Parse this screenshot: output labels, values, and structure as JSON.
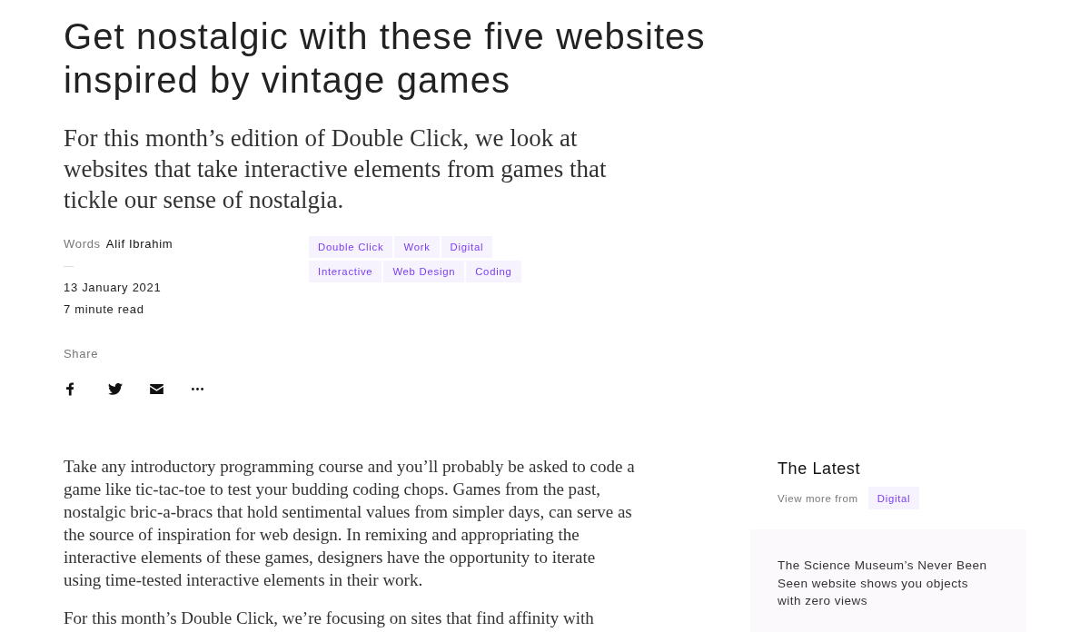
{
  "article": {
    "title": "Get nostalgic with these five websites inspired by vintage games",
    "dek": "For this month’s edition of Double Click, we look at websites that take interactive elements from games that tickle our sense of nostalgia.",
    "byline": {
      "label": "Words",
      "author": "Alif Ibrahim"
    },
    "date": "13 January 2021",
    "read_time": "7 minute read",
    "tags": [
      "Double Click",
      "Work",
      "Digital",
      "Interactive",
      "Web Design",
      "Coding"
    ],
    "share": {
      "label": "Share",
      "buttons": [
        {
          "kind": "facebook"
        },
        {
          "kind": "twitter"
        },
        {
          "kind": "email"
        },
        {
          "kind": "more"
        }
      ]
    },
    "body": [
      "Take any introductory programming course and you’ll probably be asked to code a game like tic-tac-toe to test your budding coding chops. Games from the past, nostalgic bric-a-bracs that hold sentimental values from simpler days, can serve as the source of inspiration for web design. In remixing and appropriating the interactive elements of these games, designers have the opportunity to iterate using time-tested interactive elements in their work.",
      "For this month’s Double Click, we’re focusing on sites that find affinity with"
    ]
  },
  "sidebar": {
    "heading": "The Latest",
    "view_more": {
      "label": "View more from",
      "tag": "Digital"
    },
    "cards": [
      {
        "title": "The Science Museum’s Never Been Seen website shows you objects with zero views"
      }
    ]
  }
}
